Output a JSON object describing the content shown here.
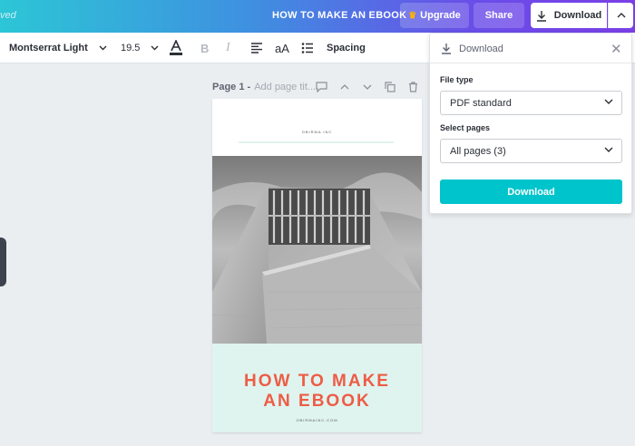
{
  "topbar": {
    "saved_text": "ved",
    "doc_title": "HOW TO MAKE AN EBOOK",
    "upgrade_label": "Upgrade",
    "share_label": "Share",
    "download_label": "Download"
  },
  "toolbar": {
    "font_family": "Montserrat Light",
    "font_size": "19.5",
    "bold_label": "B",
    "italic_label": "I",
    "case_label": "aA",
    "spacing_label": "Spacing"
  },
  "page_header": {
    "label": "Page 1 -",
    "title_placeholder": "Add page tit..."
  },
  "page": {
    "brand_top": "OBIRMA INC",
    "cover_title_line1": "HOW TO MAKE",
    "cover_title_line2": "AN EBOOK",
    "cover_site": "OBIRMAINC.COM",
    "title_color": "#ee5c45",
    "band_color": "#dff4ef"
  },
  "download_panel": {
    "title": "Download",
    "file_type_label": "File type",
    "file_type_value": "PDF standard",
    "select_pages_label": "Select pages",
    "select_pages_value": "All pages (3)",
    "download_button": "Download",
    "accent": "#00c4cc"
  },
  "icons": [
    "crown-icon",
    "download-icon",
    "chevron-up-icon",
    "chevron-down-icon",
    "text-color-icon",
    "align-left-icon",
    "list-icon",
    "comment-icon",
    "copy-icon",
    "trash-icon",
    "close-icon"
  ]
}
